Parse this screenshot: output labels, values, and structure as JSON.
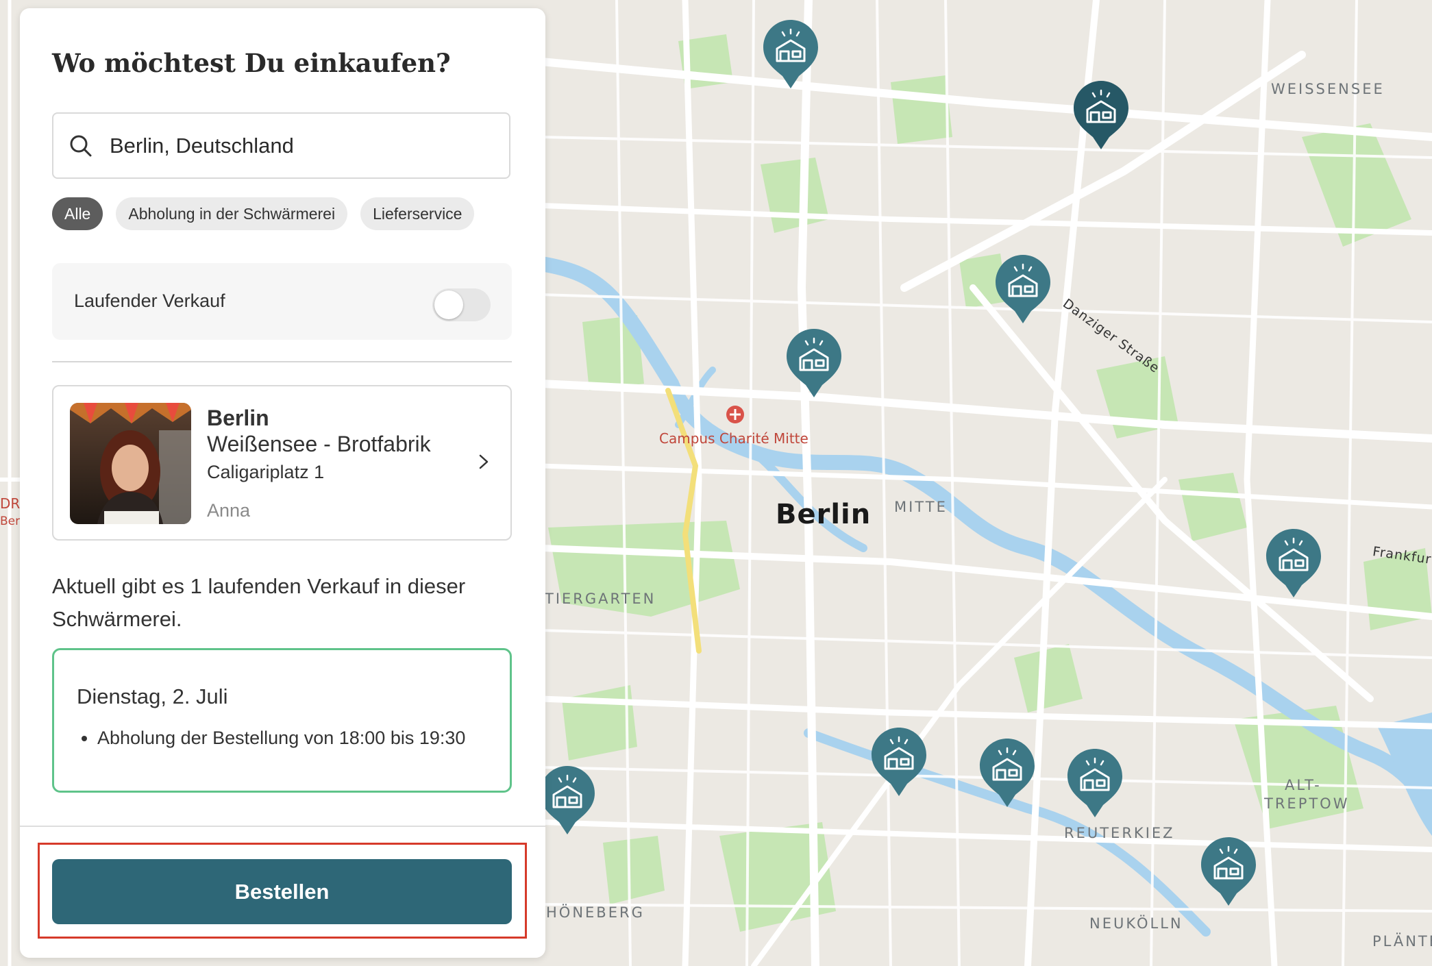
{
  "panel": {
    "title": "Wo möchtest Du einkaufen?",
    "search": {
      "value": "Berlin, Deutschland",
      "icon": "search-icon"
    },
    "filters": [
      {
        "label": "Alle",
        "active": true
      },
      {
        "label": "Abholung in der Schwärmerei",
        "active": false
      },
      {
        "label": "Lieferservice",
        "active": false
      }
    ],
    "toggle": {
      "label": "Laufender Verkauf",
      "on": false
    },
    "store": {
      "city": "Berlin",
      "name": "Weißensee - Brotfabrik",
      "address": "Caligariplatz 1",
      "host": "Anna"
    },
    "sale_text": "Aktuell gibt es 1 laufenden Verkauf in dieser Schwärmerei.",
    "sale": {
      "date": "Dienstag, 2. Juli",
      "details": [
        "Abholung der Bestellung von 18:00 bis 19:30"
      ]
    },
    "order_button": "Bestellen"
  },
  "map": {
    "labels": {
      "city": "Berlin",
      "weissensee": "WEISSENSEE",
      "mitte": "MITTE",
      "tiergarten": "TIERGARTEN",
      "alt_treptow_1": "ALT-",
      "alt_treptow_2": "TREPTOW",
      "reuterkiez": "REUTERKIEZ",
      "neukoelln": "NEUKÖLLN",
      "schoeneberg": "HÖNEBERG",
      "plaenter": "PLÄNTE",
      "ddr_1": "DR",
      "ddr_2": "Berl",
      "poi_charite": "Campus Charité Mitte",
      "street_danziger": "Danziger Straße",
      "street_frankfurter": "Frankfur"
    },
    "marker_icon": "farm-shop-marker-icon",
    "colors": {
      "marker": "#3d7886",
      "marker_active": "#265866",
      "water": "#a9d2ee",
      "park": "#bfe3ad",
      "road": "#ffffff",
      "highlight_road": "#f3df7a",
      "brand_button": "#2e6777",
      "accent_border": "#5fc38a"
    }
  }
}
